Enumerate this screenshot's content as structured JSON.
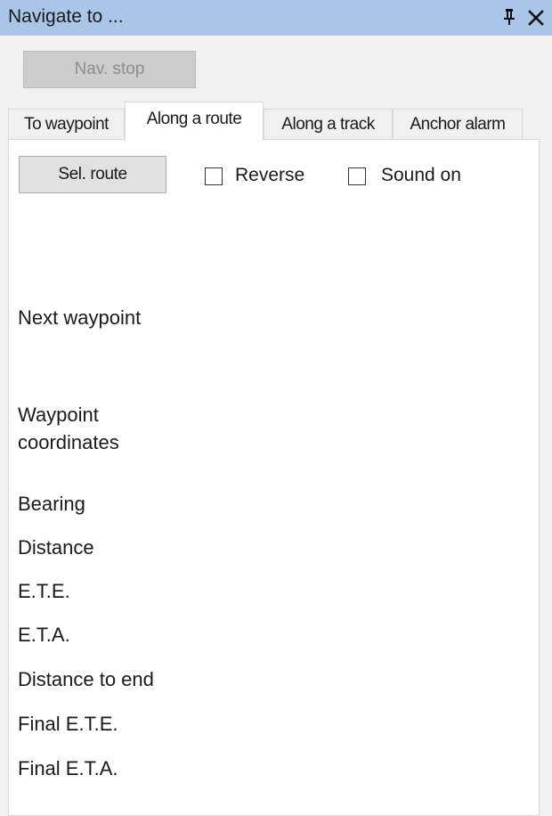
{
  "window": {
    "title": "Navigate to ...",
    "pin_icon": "pin-icon",
    "close_icon": "close-icon"
  },
  "toolbar": {
    "nav_stop_label": "Nav. stop"
  },
  "tabs": [
    {
      "label": "To waypoint",
      "active": false
    },
    {
      "label": "Along a route",
      "active": true
    },
    {
      "label": "Along a track",
      "active": false
    },
    {
      "label": "Anchor alarm",
      "active": false
    }
  ],
  "route_panel": {
    "sel_route_label": "Sel. route",
    "reverse": {
      "label": "Reverse",
      "checked": false
    },
    "sound_on": {
      "label": "Sound on",
      "checked": false
    },
    "fields": {
      "next_waypoint": "Next waypoint",
      "waypoint_coordinates_line1": "Waypoint",
      "waypoint_coordinates_line2": "coordinates",
      "bearing": "Bearing",
      "distance": "Distance",
      "ete": "E.T.E.",
      "eta": "E.T.A.",
      "distance_to_end": "Distance to end",
      "final_ete": "Final E.T.E.",
      "final_eta": "Final E.T.A."
    }
  },
  "colors": {
    "titlebar": "#a9c5e8",
    "panel_bg": "#ffffff",
    "window_bg": "#f0f0f0"
  }
}
